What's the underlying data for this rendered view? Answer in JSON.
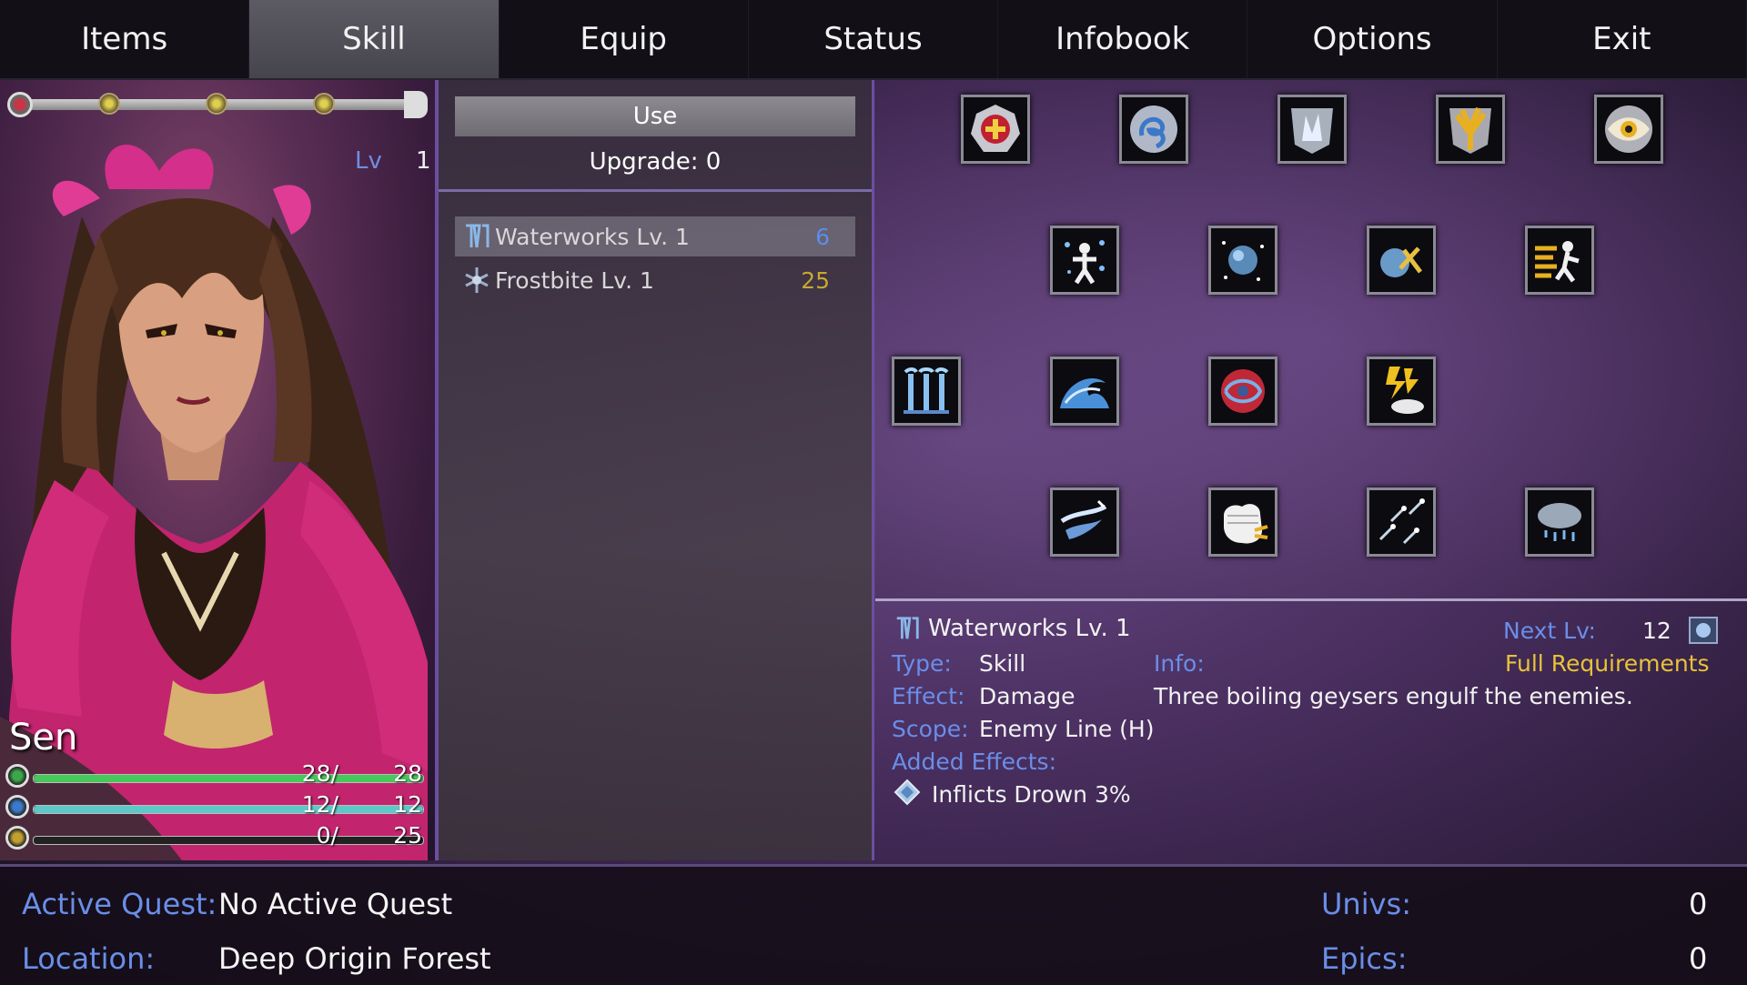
{
  "menu": {
    "tabs": [
      {
        "label": "Items"
      },
      {
        "label": "Skill",
        "active": true
      },
      {
        "label": "Equip"
      },
      {
        "label": "Status"
      },
      {
        "label": "Infobook"
      },
      {
        "label": "Options"
      },
      {
        "label": "Exit"
      }
    ]
  },
  "character": {
    "name": "Sen",
    "level_label": "Lv",
    "level": "1",
    "stats": [
      {
        "current": "28/",
        "max": "28",
        "fraction": 1.0,
        "color": "#46c85a",
        "orb": "#3aa84a"
      },
      {
        "current": "12/",
        "max": "12",
        "fraction": 1.0,
        "color": "#5ec8c8",
        "orb": "#3a7ac8"
      },
      {
        "current": "0/",
        "max": "25",
        "fraction": 0.0,
        "color": "#e0c040",
        "orb": "#c0a030"
      }
    ]
  },
  "skill_actions": {
    "use_label": "Use",
    "upgrade_label": "Upgrade: 0"
  },
  "skill_list": [
    {
      "name": "Waterworks  Lv. 1",
      "cost": "6",
      "icon": "waterworks-icon",
      "selected": true,
      "cost_color": "#5a8ee8"
    },
    {
      "name": "Frostbite  Lv. 1",
      "cost": "25",
      "icon": "frostbite-icon",
      "selected": false,
      "cost_color": "#c8a830"
    }
  ],
  "skill_grid": [
    {
      "icon": "heal-cross-icon",
      "name": "grid-heal-cross"
    },
    {
      "icon": "swirl-icon",
      "name": "grid-swirl"
    },
    {
      "icon": "ice-shield-icon",
      "name": "grid-ice-shield"
    },
    {
      "icon": "golden-branch-icon",
      "name": "grid-golden-branch"
    },
    {
      "icon": "eye-icon",
      "name": "grid-eye"
    },
    {
      "icon": "sparkle-figure-icon",
      "name": "grid-sparkle-figure"
    },
    {
      "icon": "orb-icon",
      "name": "grid-orb"
    },
    {
      "icon": "orb-strike-icon",
      "name": "grid-orb-strike"
    },
    {
      "icon": "dash-figure-icon",
      "name": "grid-dash-figure"
    },
    {
      "icon": "waterworks-icon",
      "name": "grid-waterworks"
    },
    {
      "icon": "wave-icon",
      "name": "grid-wave"
    },
    {
      "icon": "red-vortex-icon",
      "name": "grid-red-vortex"
    },
    {
      "icon": "lightning-cloud-icon",
      "name": "grid-lightning-cloud"
    },
    {
      "icon": "wind-slash-icon",
      "name": "grid-wind-slash"
    },
    {
      "icon": "fist-icon",
      "name": "grid-fist"
    },
    {
      "icon": "meteor-shower-icon",
      "name": "grid-meteor-shower"
    },
    {
      "icon": "storm-cloud-icon",
      "name": "grid-storm-cloud"
    }
  ],
  "skill_info": {
    "title": "Waterworks  Lv. 1",
    "next_lv_label": "Next Lv:",
    "next_lv_value": "12",
    "type_label": "Type:",
    "type_value": "Skill",
    "effect_label": "Effect:",
    "effect_value": "Damage",
    "scope_label": "Scope:",
    "scope_value": "Enemy Line (H)",
    "added_effects_label": "Added Effects:",
    "added_effect": "Inflicts Drown 3%",
    "info_label": "Info:",
    "full_requirements": "Full Requirements",
    "description": "Three boiling geysers engulf the enemies."
  },
  "footer": {
    "active_quest_label": "Active Quest:",
    "active_quest_value": "No Active Quest",
    "location_label": "Location:",
    "location_value": "Deep Origin Forest",
    "univs_label": "Univs:",
    "univs_value": "0",
    "epics_label": "Epics:",
    "epics_value": "0"
  },
  "colors": {
    "label_blue": "#6a8ee8",
    "gold": "#e8c23a",
    "accent_purple": "#6a4fa0"
  }
}
